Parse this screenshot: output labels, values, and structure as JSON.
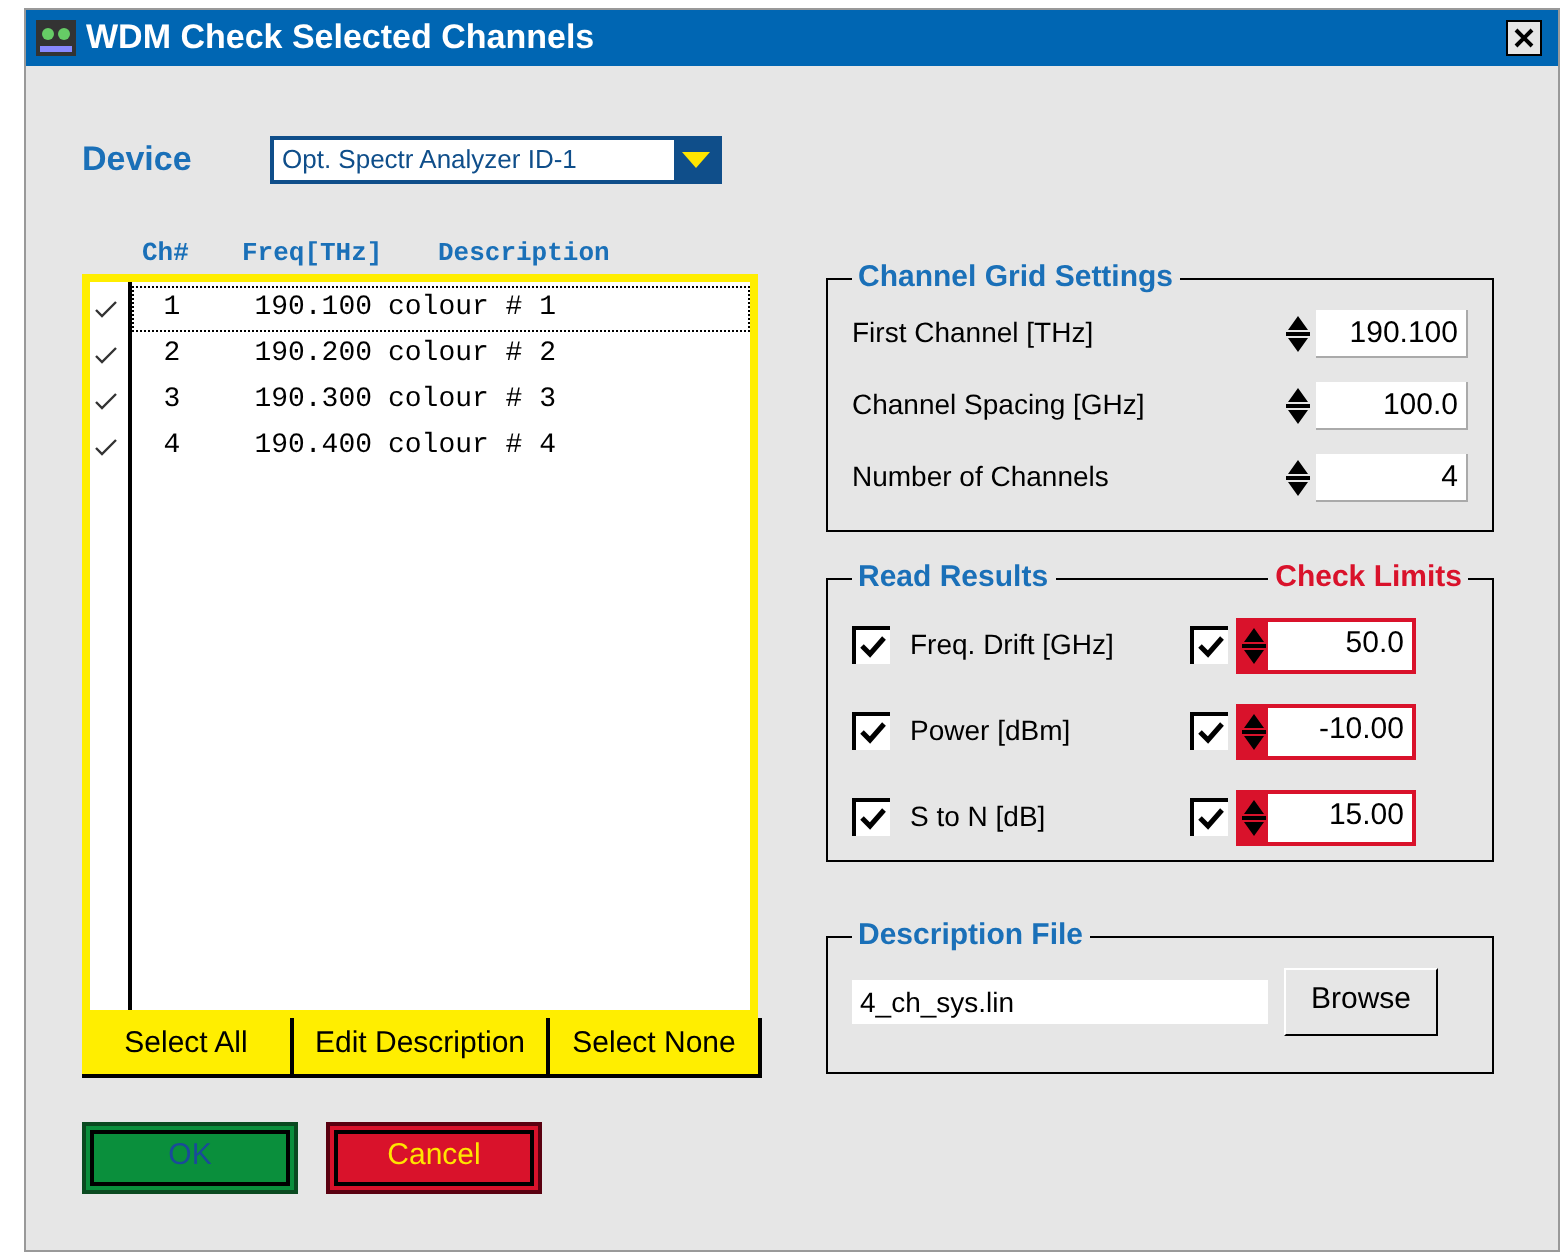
{
  "window": {
    "title": "WDM Check Selected Channels"
  },
  "device": {
    "label": "Device",
    "value": "Opt. Spectr Analyzer ID-1"
  },
  "channel_list": {
    "columns": [
      "Ch#",
      "Freq[THz]",
      "Description"
    ],
    "rows": [
      {
        "checked": true,
        "selected": true,
        "channel": "1",
        "freq": "190.100",
        "description": "colour # 1"
      },
      {
        "checked": true,
        "selected": false,
        "channel": "2",
        "freq": "190.200",
        "description": "colour # 2"
      },
      {
        "checked": true,
        "selected": false,
        "channel": "3",
        "freq": "190.300",
        "description": "colour # 3"
      },
      {
        "checked": true,
        "selected": false,
        "channel": "4",
        "freq": "190.400",
        "description": "colour # 4"
      }
    ],
    "buttons": [
      "Select All",
      "Edit Description",
      "Select None"
    ]
  },
  "channel_grid": {
    "title": "Channel Grid Settings",
    "fields": [
      {
        "label": "First Channel [THz]",
        "value": "190.100"
      },
      {
        "label": "Channel Spacing [GHz]",
        "value": "100.0"
      },
      {
        "label": "Number of Channels",
        "value": "4"
      }
    ]
  },
  "results": {
    "title": "Read Results",
    "limits_title": "Check Limits",
    "rows": [
      {
        "label": "Freq. Drift [GHz]",
        "read": true,
        "check": true,
        "limit": "50.0"
      },
      {
        "label": "Power [dBm]",
        "read": true,
        "check": true,
        "limit": "-10.00"
      },
      {
        "label": "S to N [dB]",
        "read": true,
        "check": true,
        "limit": "15.00"
      }
    ]
  },
  "description_file": {
    "title": "Description File",
    "value": "4_ch_sys.lin",
    "button": "Browse"
  },
  "buttons": [
    {
      "kind": "ok",
      "label": "OK"
    },
    {
      "kind": "cancel",
      "label": "Cancel"
    }
  ]
}
